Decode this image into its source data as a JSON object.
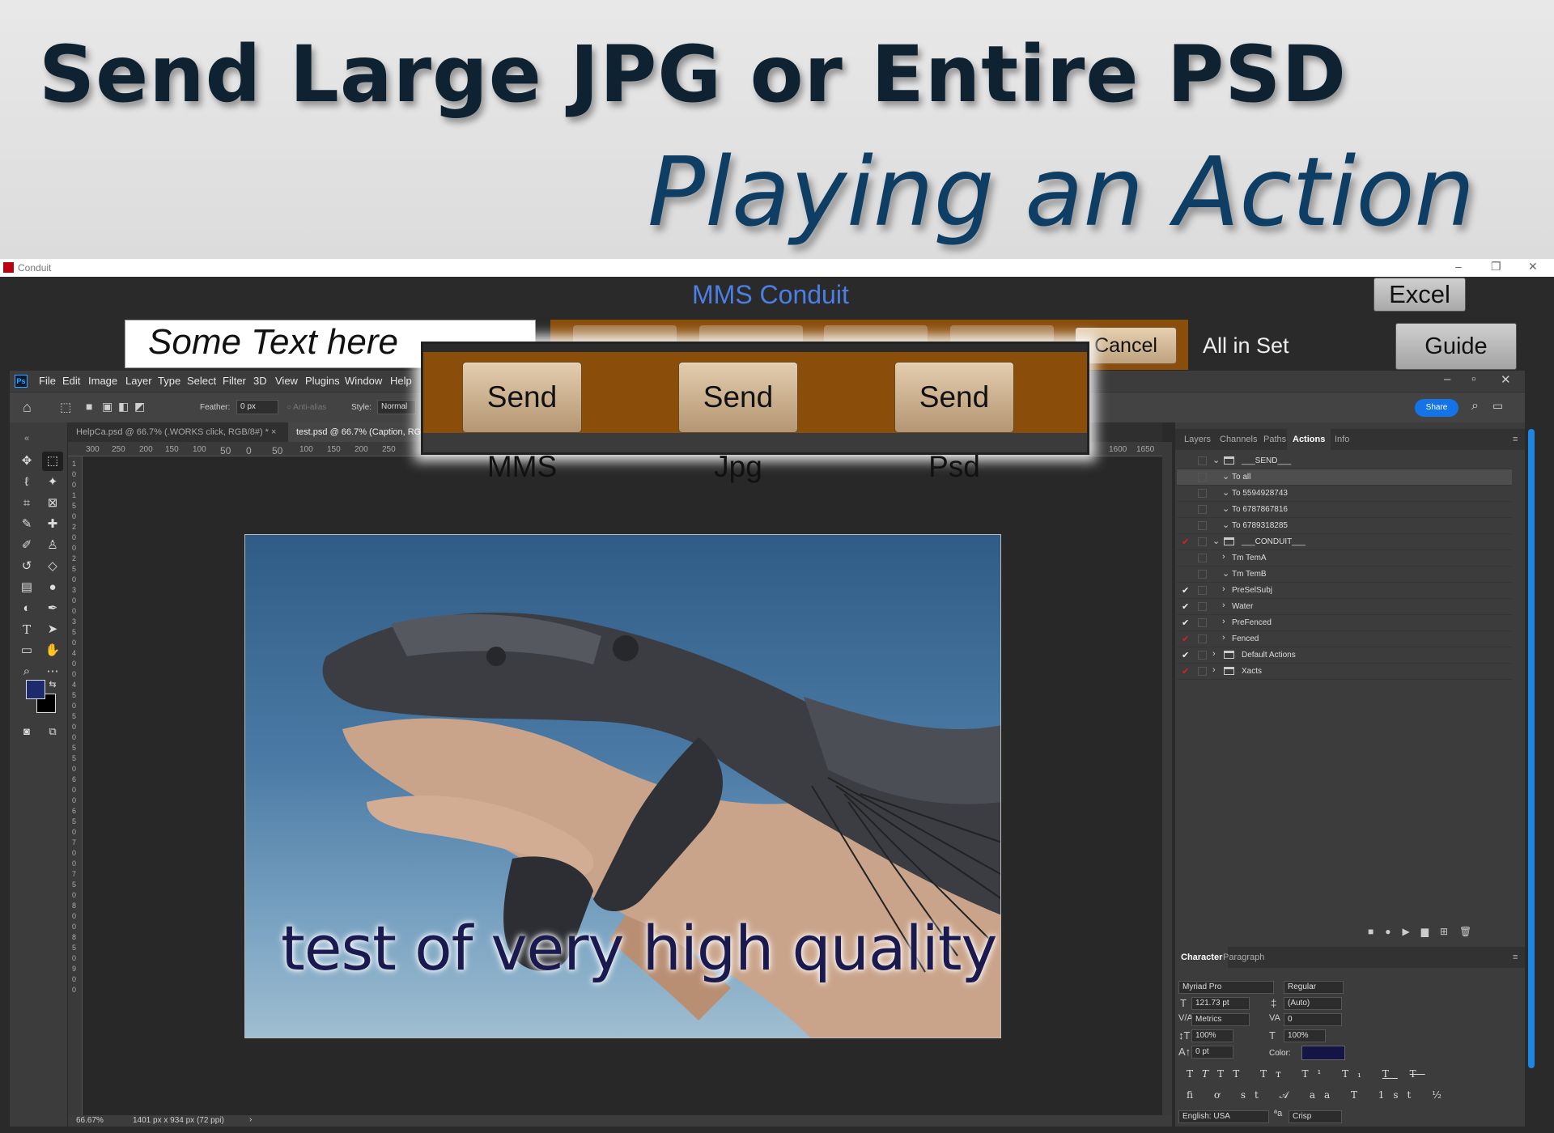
{
  "banner": {
    "title": "Send Large JPG or Entire PSD",
    "subtitle": "Playing an Action"
  },
  "conduit": {
    "window_title": "Conduit",
    "heading": "MMS Conduit",
    "text_input_value": "Some Text here",
    "cancel_label": "Cancel",
    "all_in_set_label": "All in Set",
    "excel_label": "Excel",
    "guide_label": "Guide",
    "popup": {
      "send_mms_label": "Send MMS",
      "send_jpg_label": "Send Jpg",
      "send_psd_label": "Send Psd"
    },
    "colors": {
      "button_bar": "#8a4d0a",
      "heading": "#4b7fe6"
    }
  },
  "photoshop": {
    "menu": [
      "File",
      "Edit",
      "Image",
      "Layer",
      "Type",
      "Select",
      "Filter",
      "3D",
      "View",
      "Plugins",
      "Window",
      "Help"
    ],
    "options": {
      "feather_label": "Feather:",
      "feather_value": "0 px",
      "antialias_label": "Anti-alias",
      "style_label": "Style:",
      "style_value": "Normal",
      "share_label": "Share"
    },
    "tabs": [
      {
        "label": "HelpCa.psd @ 66.7% (.WORKS click, RGB/8#) *"
      },
      {
        "label": "test.psd @ 66.7% (Caption, RGB/8#) *"
      }
    ],
    "ruler_top": [
      "300",
      "250",
      "200",
      "150",
      "100",
      "50",
      "0",
      "50",
      "100",
      "150",
      "200",
      "250",
      "1600",
      "1650"
    ],
    "ruler_left": [
      "1",
      "0",
      "0",
      "1",
      "5",
      "0",
      "2",
      "0",
      "0",
      "2",
      "5",
      "0",
      "3",
      "0",
      "0",
      "3",
      "5",
      "0",
      "4",
      "0",
      "0",
      "4",
      "5",
      "0",
      "5",
      "0",
      "0",
      "5",
      "5",
      "0",
      "6",
      "0",
      "0",
      "6",
      "5",
      "0",
      "7",
      "0",
      "0",
      "7",
      "5",
      "0",
      "8",
      "0",
      "0",
      "8",
      "5",
      "0",
      "9",
      "0",
      "0"
    ],
    "canvas_caption": "test of very high quality",
    "status": {
      "zoom": "66.67%",
      "doc_info": "1401 px x 934 px (72 ppi)"
    },
    "panel_tabs": [
      "Layers",
      "Channels",
      "Paths",
      "Actions",
      "Info"
    ],
    "active_panel_tab": "Actions",
    "actions": [
      {
        "label": "___SEND___",
        "kind": "set",
        "expanded": true,
        "checked": "none"
      },
      {
        "label": "To all",
        "kind": "action",
        "expanded": true,
        "checked": "none",
        "selected": true
      },
      {
        "label": "To 5594928743",
        "kind": "action",
        "expanded": true,
        "checked": "none"
      },
      {
        "label": "To 6787867816",
        "kind": "action",
        "expanded": true,
        "checked": "none"
      },
      {
        "label": "To 6789318285",
        "kind": "action",
        "expanded": true,
        "checked": "none"
      },
      {
        "label": "___CONDUIT___",
        "kind": "set",
        "expanded": true,
        "checked": "red"
      },
      {
        "label": "Tm TemA",
        "kind": "action",
        "expanded": false,
        "checked": "none"
      },
      {
        "label": "Tm TemB",
        "kind": "action",
        "expanded": true,
        "checked": "none"
      },
      {
        "label": "PreSelSubj",
        "kind": "action",
        "expanded": false,
        "checked": "white"
      },
      {
        "label": "Water",
        "kind": "action",
        "expanded": false,
        "checked": "white"
      },
      {
        "label": "PreFenced",
        "kind": "action",
        "expanded": false,
        "checked": "white"
      },
      {
        "label": "Fenced",
        "kind": "action",
        "expanded": false,
        "checked": "red"
      },
      {
        "label": "Default Actions",
        "kind": "set-closed",
        "expanded": false,
        "checked": "white"
      },
      {
        "label": "Xacts",
        "kind": "set-closed",
        "expanded": false,
        "checked": "red"
      }
    ],
    "character": {
      "tabs": [
        "Character",
        "Paragraph"
      ],
      "font_family": "Myriad Pro",
      "font_style": "Regular",
      "font_size": "121.73 pt",
      "leading": "(Auto)",
      "kerning": "Metrics",
      "tracking": "0",
      "vertical_scale": "100%",
      "horizontal_scale": "100%",
      "baseline_shift": "0 pt",
      "color_label": "Color:",
      "color": "#141446",
      "language": "English: USA",
      "antialias": "Crisp"
    },
    "tool_icons": [
      "move-icon",
      "marquee-icon",
      "lasso-icon",
      "magic-wand-icon",
      "crop-icon",
      "frame-icon",
      "eyedropper-icon",
      "healing-icon",
      "brush-icon",
      "stamp-icon",
      "history-brush-icon",
      "eraser-icon",
      "gradient-icon",
      "blur-icon",
      "dodge-icon",
      "pen-icon",
      "type-icon",
      "path-select-icon",
      "rectangle-icon",
      "hand-icon",
      "zoom-icon",
      "more-icon"
    ]
  }
}
